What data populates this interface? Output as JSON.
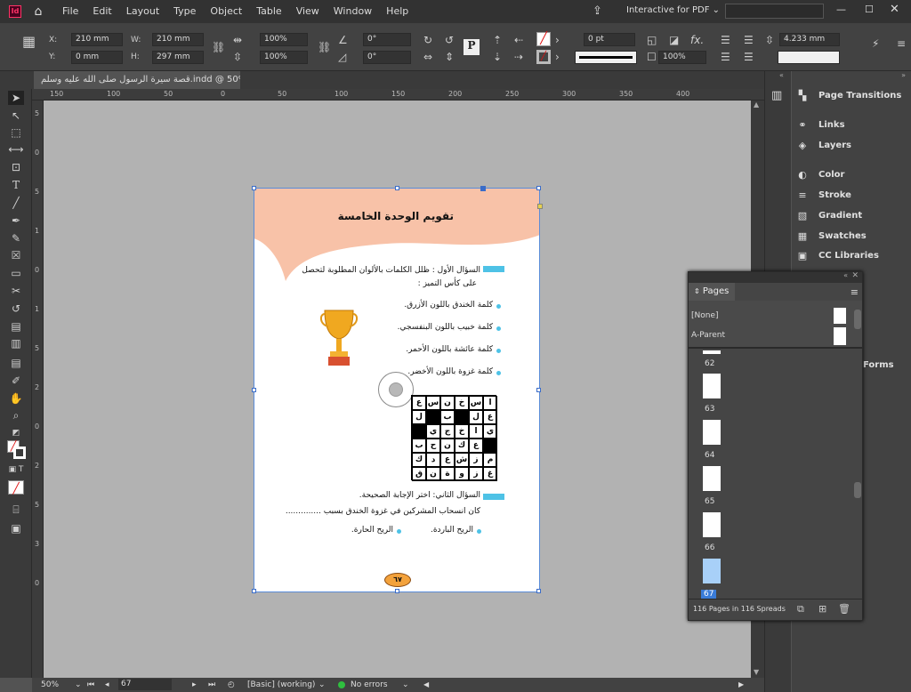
{
  "app": {
    "logo": "Id"
  },
  "menu": [
    "File",
    "Edit",
    "Layout",
    "Type",
    "Object",
    "Table",
    "View",
    "Window",
    "Help"
  ],
  "workspace": {
    "label": "Interactive for PDF"
  },
  "control": {
    "x": "210 mm",
    "y": "0 mm",
    "w": "210 mm",
    "h": "297 mm",
    "x_label": "X:",
    "y_label": "Y:",
    "w_label": "W:",
    "h_label": "H:",
    "scale_x": "100%",
    "scale_y": "100%",
    "rotate": "0°",
    "shear": "0°",
    "stroke_weight": "0 pt",
    "opacity": "100%",
    "measure": "4.233 mm"
  },
  "document": {
    "tab_title": "قصة سيرة الرسول صلى الله عليه وسلم.indd @ 50%",
    "close": "×"
  },
  "ruler": {
    "h": [
      "150",
      "100",
      "50",
      "0",
      "50",
      "100",
      "150",
      "200",
      "250",
      "300",
      "350",
      "400"
    ],
    "v": [
      "5",
      "0",
      "5",
      "1",
      "0",
      "1",
      "5",
      "2",
      "0",
      "2",
      "5",
      "3",
      "0"
    ]
  },
  "page": {
    "title": "تقويم الوحدة الخامسة",
    "q1": "السؤال الأول : ظلل الكلمات بالألوان المطلوبة لتحصل",
    "q1b": "على كأس التميز :",
    "items": [
      "كلمة الخندق باللون الأزرق.",
      "كلمة خبيب باللون البنفسجي.",
      "كلمة عائشة باللون الأحمر.",
      "كلمة غزوة باللون الأخضر."
    ],
    "grid": [
      [
        "ا",
        "س",
        "خ",
        "ن",
        "س",
        "ع"
      ],
      [
        "ع",
        "ل",
        "",
        "ب",
        "",
        "ل"
      ],
      [
        "ي",
        "ا",
        "خ",
        "ج",
        "ي",
        ""
      ],
      [
        "",
        "ع",
        "ك",
        "ن",
        "ح",
        "ب"
      ],
      [
        "م",
        "ز",
        "ش",
        "ع",
        "د",
        "ك"
      ],
      [
        "غ",
        "ز",
        "و",
        "ة",
        "ن",
        "ق"
      ]
    ],
    "q2": "السؤال الثاني: اختر الإجابة الصحيحة.",
    "q2b": "كان انسحاب المشركين في غزوة الخندق بسبب ..............",
    "opt1": "الريح الباردة.",
    "opt2": "الريح الحارة.",
    "page_num": "٦٧"
  },
  "panels": [
    "Page Transitions",
    "Links",
    "Layers",
    "Color",
    "Stroke",
    "Gradient",
    "Swatches",
    "CC Libraries",
    "Forms"
  ],
  "pages_panel": {
    "title": "Pages",
    "masters": [
      "[None]",
      "A-Parent"
    ],
    "thumbs": [
      "62",
      "63",
      "64",
      "65",
      "66",
      "67"
    ],
    "summary": "116 Pages in 116 Spreads"
  },
  "status": {
    "zoom": "50%",
    "page": "67",
    "style": "[Basic] (working)",
    "errors": "No errors"
  }
}
